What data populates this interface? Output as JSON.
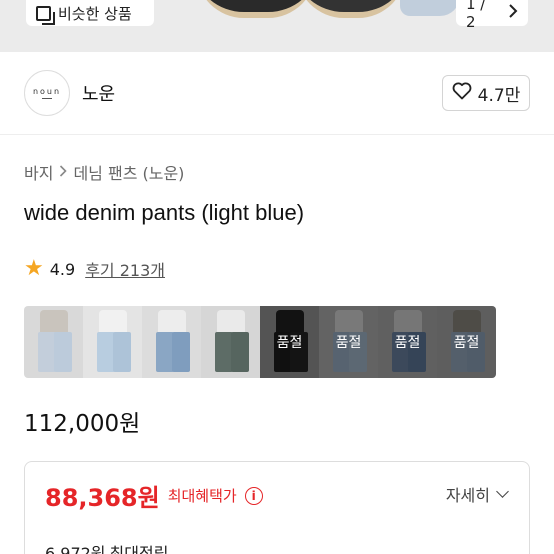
{
  "gallery": {
    "similar_label": "비슷한 상품",
    "pager": "1 / 2"
  },
  "shop": {
    "logo_text": "noun",
    "name": "노운",
    "likes": "4.7만"
  },
  "breadcrumb": [
    "바지",
    "데님 팬츠 (노운)"
  ],
  "product": {
    "title": "wide denim pants (light blue)",
    "rating": "4.9",
    "reviews": "후기 213개",
    "price": "112,000원"
  },
  "thumbnails": [
    {
      "soldout": ""
    },
    {
      "soldout": ""
    },
    {
      "soldout": ""
    },
    {
      "soldout": ""
    },
    {
      "soldout": "품절"
    },
    {
      "soldout": "품절"
    },
    {
      "soldout": "품절"
    },
    {
      "soldout": "품절"
    }
  ],
  "benefit": {
    "max_price": "88,368원",
    "max_label": "최대혜택가",
    "detail_label": "자세히",
    "points": "6,972원",
    "points_label": "최대적립"
  },
  "colors": {
    "accent_red": "#e52528",
    "star": "#f5a623"
  },
  "icons": {
    "similar": "similar-items-icon",
    "pager_next": "chevron-right-icon",
    "heart": "heart-icon",
    "star": "star-icon",
    "info": "info-icon",
    "expand": "chevron-down-icon"
  }
}
